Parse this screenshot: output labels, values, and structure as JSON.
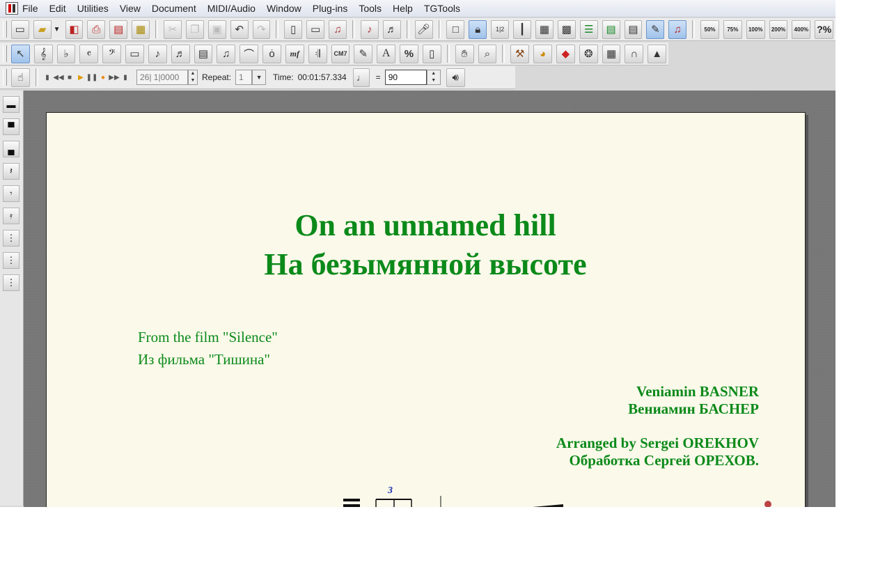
{
  "menu": [
    "File",
    "Edit",
    "Utilities",
    "View",
    "Document",
    "MIDI/Audio",
    "Window",
    "Plug-ins",
    "Tools",
    "Help",
    "TGTools"
  ],
  "toolbar1": {
    "zoom": [
      "50%",
      "75%",
      "100%",
      "200%",
      "400%",
      "?%"
    ]
  },
  "toolbar2": {
    "chord_label": "CM7",
    "mf_label": "mf",
    "text_tool_label": "A",
    "percent_label": "%"
  },
  "transport": {
    "counter": "26| 1|0000",
    "repeat_label": "Repeat:",
    "repeat_value": "1",
    "time_label": "Time:",
    "time_value": "00:01:57.334",
    "tempo_equals": "=",
    "tempo_value": "90"
  },
  "document": {
    "title_en": "On an unnamed hill",
    "title_ru": "На безымянной высоте",
    "subtitle_en": "From the film \"Silence\"",
    "subtitle_ru": "Из фильма \"Тишина\"",
    "composer_en": "Veniamin BASNER",
    "composer_ru": "Вениамин БАСНЕР",
    "arranger_en": "Arranged by Sergei OREKHOV",
    "arranger_ru": "Обработка Сергей ОРЕХОВ.",
    "tuplet_number": "3"
  }
}
